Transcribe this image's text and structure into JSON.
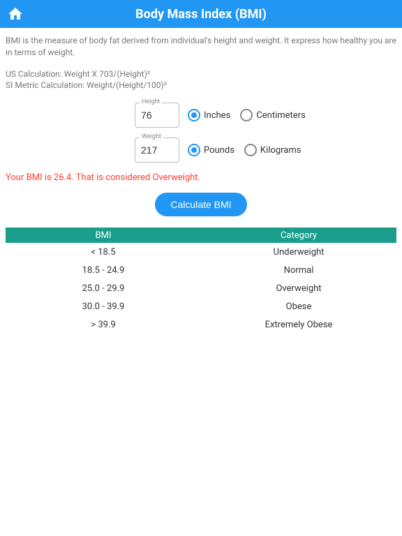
{
  "header": {
    "title": "Body Mass Index (BMI)"
  },
  "intro": "BMI is the measure of body fat derived from individual's height and weight. It express how healthy you are in terms of weight.",
  "formulas": {
    "us": "US Calculation: Weight X 703/(Height)²",
    "si": "SI Metric Calculation: Weight/(Height/100)²"
  },
  "inputs": {
    "height": {
      "label": "Height",
      "value": "76",
      "options": [
        {
          "label": "Inches",
          "selected": true
        },
        {
          "label": "Centimeters",
          "selected": false
        }
      ]
    },
    "weight": {
      "label": "Weight",
      "value": "217",
      "options": [
        {
          "label": "Pounds",
          "selected": true
        },
        {
          "label": "Kilograms",
          "selected": false
        }
      ]
    }
  },
  "result": "Your BMI is 26.4. That is considered Overweight.",
  "calculate_button": "Calculate BMI",
  "table": {
    "headers": [
      "BMI",
      "Category"
    ],
    "rows": [
      {
        "bmi": "< 18.5",
        "category": "Underweight"
      },
      {
        "bmi": "18.5 - 24.9",
        "category": "Normal"
      },
      {
        "bmi": "25.0 - 29.9",
        "category": "Overweight"
      },
      {
        "bmi": "30.0 - 39.9",
        "category": "Obese"
      },
      {
        "bmi": "> 39.9",
        "category": "Extremely Obese"
      }
    ]
  }
}
